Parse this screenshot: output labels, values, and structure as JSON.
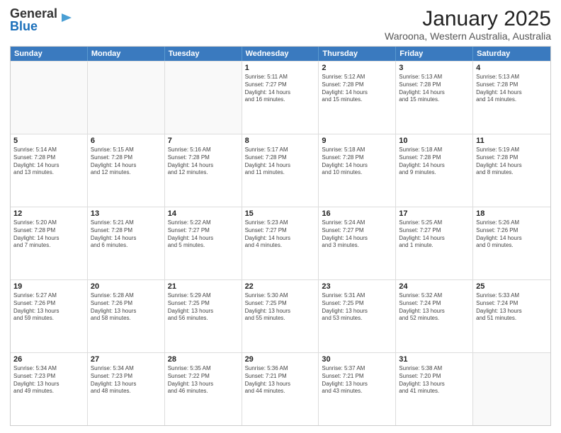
{
  "header": {
    "logo_general": "General",
    "logo_blue": "Blue",
    "month_title": "January 2025",
    "location": "Waroona, Western Australia, Australia"
  },
  "days_of_week": [
    "Sunday",
    "Monday",
    "Tuesday",
    "Wednesday",
    "Thursday",
    "Friday",
    "Saturday"
  ],
  "weeks": [
    [
      {
        "day": "",
        "info": ""
      },
      {
        "day": "",
        "info": ""
      },
      {
        "day": "",
        "info": ""
      },
      {
        "day": "1",
        "info": "Sunrise: 5:11 AM\nSunset: 7:27 PM\nDaylight: 14 hours\nand 16 minutes."
      },
      {
        "day": "2",
        "info": "Sunrise: 5:12 AM\nSunset: 7:28 PM\nDaylight: 14 hours\nand 15 minutes."
      },
      {
        "day": "3",
        "info": "Sunrise: 5:13 AM\nSunset: 7:28 PM\nDaylight: 14 hours\nand 15 minutes."
      },
      {
        "day": "4",
        "info": "Sunrise: 5:13 AM\nSunset: 7:28 PM\nDaylight: 14 hours\nand 14 minutes."
      }
    ],
    [
      {
        "day": "5",
        "info": "Sunrise: 5:14 AM\nSunset: 7:28 PM\nDaylight: 14 hours\nand 13 minutes."
      },
      {
        "day": "6",
        "info": "Sunrise: 5:15 AM\nSunset: 7:28 PM\nDaylight: 14 hours\nand 12 minutes."
      },
      {
        "day": "7",
        "info": "Sunrise: 5:16 AM\nSunset: 7:28 PM\nDaylight: 14 hours\nand 12 minutes."
      },
      {
        "day": "8",
        "info": "Sunrise: 5:17 AM\nSunset: 7:28 PM\nDaylight: 14 hours\nand 11 minutes."
      },
      {
        "day": "9",
        "info": "Sunrise: 5:18 AM\nSunset: 7:28 PM\nDaylight: 14 hours\nand 10 minutes."
      },
      {
        "day": "10",
        "info": "Sunrise: 5:18 AM\nSunset: 7:28 PM\nDaylight: 14 hours\nand 9 minutes."
      },
      {
        "day": "11",
        "info": "Sunrise: 5:19 AM\nSunset: 7:28 PM\nDaylight: 14 hours\nand 8 minutes."
      }
    ],
    [
      {
        "day": "12",
        "info": "Sunrise: 5:20 AM\nSunset: 7:28 PM\nDaylight: 14 hours\nand 7 minutes."
      },
      {
        "day": "13",
        "info": "Sunrise: 5:21 AM\nSunset: 7:28 PM\nDaylight: 14 hours\nand 6 minutes."
      },
      {
        "day": "14",
        "info": "Sunrise: 5:22 AM\nSunset: 7:27 PM\nDaylight: 14 hours\nand 5 minutes."
      },
      {
        "day": "15",
        "info": "Sunrise: 5:23 AM\nSunset: 7:27 PM\nDaylight: 14 hours\nand 4 minutes."
      },
      {
        "day": "16",
        "info": "Sunrise: 5:24 AM\nSunset: 7:27 PM\nDaylight: 14 hours\nand 3 minutes."
      },
      {
        "day": "17",
        "info": "Sunrise: 5:25 AM\nSunset: 7:27 PM\nDaylight: 14 hours\nand 1 minute."
      },
      {
        "day": "18",
        "info": "Sunrise: 5:26 AM\nSunset: 7:26 PM\nDaylight: 14 hours\nand 0 minutes."
      }
    ],
    [
      {
        "day": "19",
        "info": "Sunrise: 5:27 AM\nSunset: 7:26 PM\nDaylight: 13 hours\nand 59 minutes."
      },
      {
        "day": "20",
        "info": "Sunrise: 5:28 AM\nSunset: 7:26 PM\nDaylight: 13 hours\nand 58 minutes."
      },
      {
        "day": "21",
        "info": "Sunrise: 5:29 AM\nSunset: 7:25 PM\nDaylight: 13 hours\nand 56 minutes."
      },
      {
        "day": "22",
        "info": "Sunrise: 5:30 AM\nSunset: 7:25 PM\nDaylight: 13 hours\nand 55 minutes."
      },
      {
        "day": "23",
        "info": "Sunrise: 5:31 AM\nSunset: 7:25 PM\nDaylight: 13 hours\nand 53 minutes."
      },
      {
        "day": "24",
        "info": "Sunrise: 5:32 AM\nSunset: 7:24 PM\nDaylight: 13 hours\nand 52 minutes."
      },
      {
        "day": "25",
        "info": "Sunrise: 5:33 AM\nSunset: 7:24 PM\nDaylight: 13 hours\nand 51 minutes."
      }
    ],
    [
      {
        "day": "26",
        "info": "Sunrise: 5:34 AM\nSunset: 7:23 PM\nDaylight: 13 hours\nand 49 minutes."
      },
      {
        "day": "27",
        "info": "Sunrise: 5:34 AM\nSunset: 7:23 PM\nDaylight: 13 hours\nand 48 minutes."
      },
      {
        "day": "28",
        "info": "Sunrise: 5:35 AM\nSunset: 7:22 PM\nDaylight: 13 hours\nand 46 minutes."
      },
      {
        "day": "29",
        "info": "Sunrise: 5:36 AM\nSunset: 7:21 PM\nDaylight: 13 hours\nand 44 minutes."
      },
      {
        "day": "30",
        "info": "Sunrise: 5:37 AM\nSunset: 7:21 PM\nDaylight: 13 hours\nand 43 minutes."
      },
      {
        "day": "31",
        "info": "Sunrise: 5:38 AM\nSunset: 7:20 PM\nDaylight: 13 hours\nand 41 minutes."
      },
      {
        "day": "",
        "info": ""
      }
    ]
  ]
}
